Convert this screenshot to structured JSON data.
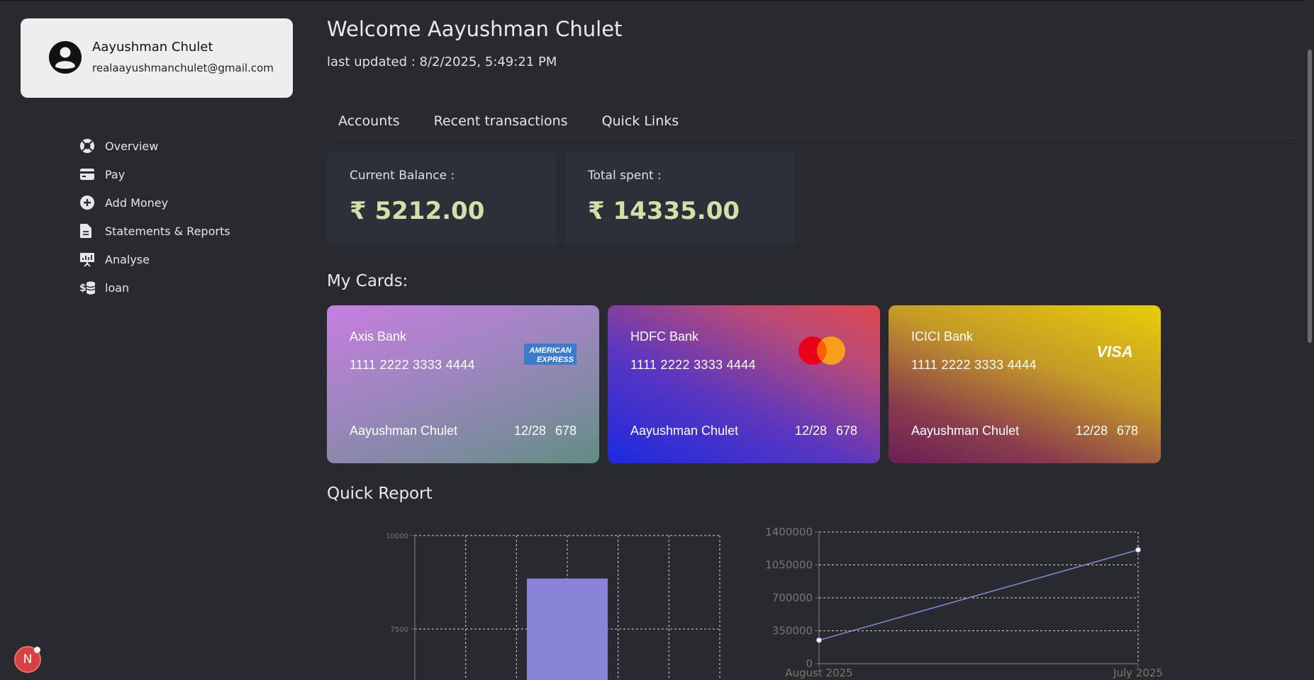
{
  "profile": {
    "name": "Aayushman Chulet",
    "email": "realaayushmanchulet@gmail.com",
    "icon": "user-circle-icon"
  },
  "sidebar": {
    "items": [
      {
        "label": "Overview",
        "icon": "lifebuoy-icon"
      },
      {
        "label": "Pay",
        "icon": "credit-card-icon"
      },
      {
        "label": "Add Money",
        "icon": "plus-circle-icon"
      },
      {
        "label": "Statements & Reports",
        "icon": "document-icon"
      },
      {
        "label": "Analyse",
        "icon": "presentation-chart-icon"
      },
      {
        "label": "loan",
        "icon": "dollar-coins-icon"
      }
    ]
  },
  "header": {
    "welcome": "Welcome Aayushman Chulet",
    "last_updated": "last updated : 8/2/2025, 5:49:21 PM"
  },
  "tabs": [
    {
      "label": "Accounts"
    },
    {
      "label": "Recent transactions"
    },
    {
      "label": "Quick Links"
    }
  ],
  "balances": {
    "current_label": "Current Balance :",
    "current_value": "₹ 5212.00",
    "spent_label": "Total spent :",
    "spent_value": "₹ 14335.00"
  },
  "cards_title": "My Cards:",
  "cards": [
    {
      "bank": "Axis Bank",
      "number": "1111 2222 3333 4444",
      "holder": "Aayushman Chulet",
      "expiry": "12/28",
      "cvv": "678",
      "network": "AMERICAN EXPRESS",
      "network_line1": "AMERICAN",
      "network_line2": "EXPRESS"
    },
    {
      "bank": "HDFC Bank",
      "number": "1111 2222 3333 4444",
      "holder": "Aayushman Chulet",
      "expiry": "12/28",
      "cvv": "678",
      "network": "mastercard"
    },
    {
      "bank": "ICICI Bank",
      "number": "1111 2222 3333 4444",
      "holder": "Aayushman Chulet",
      "expiry": "12/28",
      "cvv": "678",
      "network": "VISA"
    }
  ],
  "report_title": "Quick Report",
  "chart_data": [
    {
      "type": "bar",
      "categories": [
        ""
      ],
      "values": [
        8850
      ],
      "ylim": [
        5000,
        10000
      ],
      "yticks": [
        7500,
        10000
      ],
      "ytick_labels": [
        "7500",
        "10000"
      ],
      "grid": true,
      "color": "#8884d8"
    },
    {
      "type": "line",
      "categories": [
        "August 2025",
        "July 2025"
      ],
      "values": [
        250000,
        1210000
      ],
      "ylim": [
        0,
        1400000
      ],
      "yticks": [
        0,
        350000,
        700000,
        1050000,
        1400000
      ],
      "ytick_labels": [
        "0",
        "350000",
        "700000",
        "1050000",
        "1400000"
      ],
      "grid": true,
      "color": "#8884d8"
    }
  ],
  "fab": {
    "label": "N"
  }
}
